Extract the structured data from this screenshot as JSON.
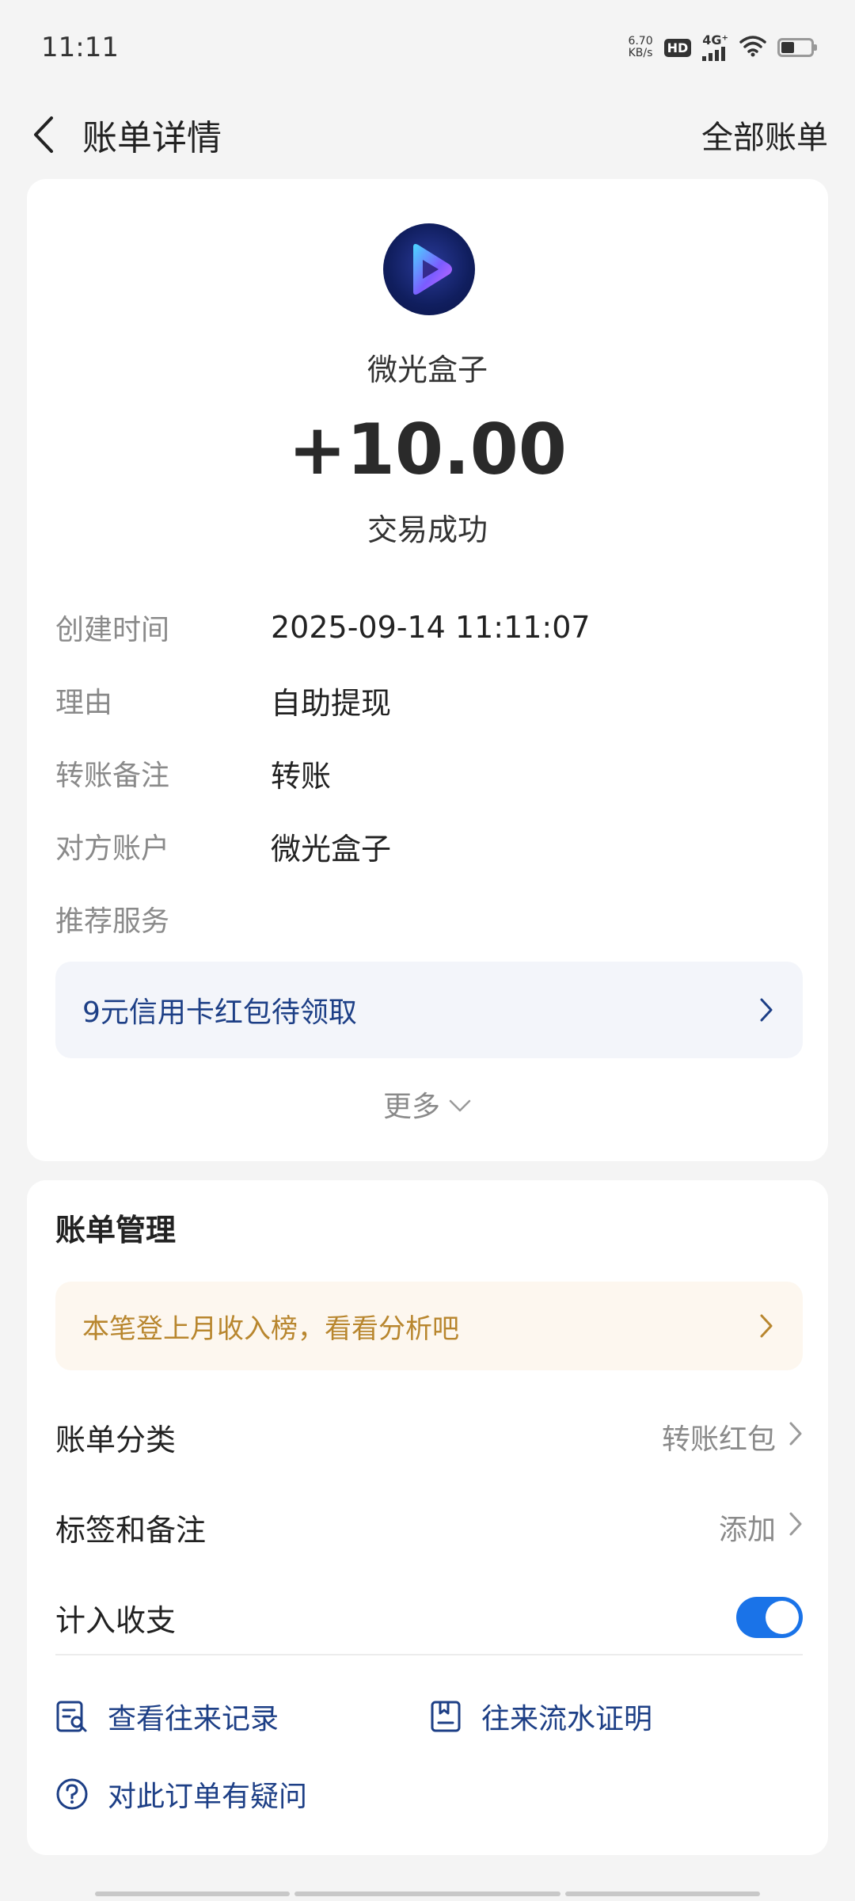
{
  "status_bar": {
    "time": "11:11",
    "net_speed_value": "6.70",
    "net_speed_unit": "KB/s",
    "hd_badge": "HD",
    "signal_label": "4G⁺"
  },
  "nav": {
    "title": "账单详情",
    "right_link": "全部账单"
  },
  "transaction": {
    "merchant_name": "微光盒子",
    "amount": "+10.00",
    "status": "交易成功",
    "details": [
      {
        "label": "创建时间",
        "value": "2025-09-14 11:11:07"
      },
      {
        "label": "理由",
        "value": "自助提现"
      },
      {
        "label": "转账备注",
        "value": "转账"
      },
      {
        "label": "对方账户",
        "value": "微光盒子"
      },
      {
        "label": "推荐服务",
        "value": ""
      }
    ],
    "promo_text": "9元信用卡红包待领取",
    "more_label": "更多"
  },
  "management": {
    "title": "账单管理",
    "tip_text": "本笔登上月收入榜，看看分析吧",
    "category_label": "账单分类",
    "category_value": "转账红包",
    "tags_label": "标签和备注",
    "tags_value": "添加",
    "include_label": "计入收支",
    "include_enabled": true,
    "actions": [
      {
        "label": "查看往来记录",
        "icon": "record-search-icon"
      },
      {
        "label": "往来流水证明",
        "icon": "statement-proof-icon"
      },
      {
        "label": "对此订单有疑问",
        "icon": "question-icon"
      }
    ]
  },
  "colors": {
    "accent_blue": "#1a73e8",
    "link_navy": "#1d3f86",
    "tip_orange": "#b8862e"
  }
}
